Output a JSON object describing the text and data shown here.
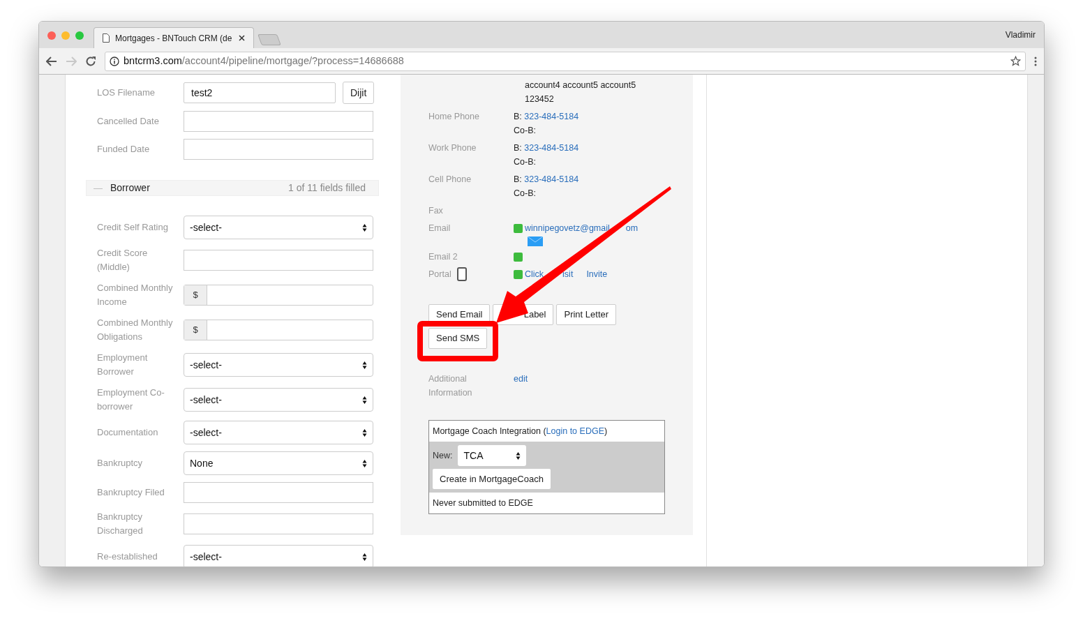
{
  "browser": {
    "tab_title": "Mortgages - BNTouch CRM (de",
    "user": "Vladimir",
    "url_host": "bntcrm3.com",
    "url_path": "/account4/pipeline/mortgage/?process=14686688"
  },
  "form": {
    "top_fields": [
      {
        "kind": "text_button",
        "label": "LOS Filename",
        "value": "test2",
        "button": "Dijit"
      },
      {
        "kind": "text",
        "label": "Cancelled Date"
      },
      {
        "kind": "text",
        "label": "Funded Date"
      }
    ],
    "section": {
      "title": "Borrower",
      "toggle": "—",
      "expanded": true,
      "summary": "1 of 11 fields filled"
    },
    "fields": [
      {
        "kind": "select",
        "label": "Credit Self Rating",
        "value": "-select-"
      },
      {
        "kind": "text",
        "label": "Credit Score (Middle)"
      },
      {
        "kind": "money",
        "label": "Combined Monthly Income",
        "prefix": "$"
      },
      {
        "kind": "money",
        "label": "Combined Monthly Obligations",
        "prefix": "$"
      },
      {
        "kind": "select",
        "label": "Employment Borrower",
        "value": "-select-"
      },
      {
        "kind": "select",
        "label": "Employment Co-borrower",
        "value": "-select-"
      },
      {
        "kind": "select",
        "label": "Documentation",
        "value": "-select-"
      },
      {
        "kind": "select",
        "label": "Bankruptcy",
        "value": "None"
      },
      {
        "kind": "text",
        "label": "Bankruptcy Filed"
      },
      {
        "kind": "text",
        "label": "Bankruptcy Discharged"
      },
      {
        "kind": "select",
        "label": "Re-established",
        "value": "-select-"
      }
    ]
  },
  "contact": {
    "address_lines": [
      "account4 account5 account5",
      "123452"
    ],
    "rows": [
      {
        "kind": "phone",
        "label": "Home Phone",
        "b": "B:",
        "phone": "323-484-5184",
        "cob": "Co-B:"
      },
      {
        "kind": "phone",
        "label": "Work Phone",
        "b": "B:",
        "phone": "323-484-5184",
        "cob": "Co-B:"
      },
      {
        "kind": "phone",
        "label": "Cell Phone",
        "b": "B:",
        "phone": "323-484-5184",
        "cob": "Co-B:"
      },
      {
        "kind": "plain",
        "label": "Fax"
      },
      {
        "kind": "email",
        "label": "Email",
        "color": "#3dbb3d",
        "link": "winnipegovetz@gmail",
        "link_tail": "om"
      },
      {
        "kind": "email",
        "label": "Email 2",
        "color": "#3dbb3d"
      },
      {
        "kind": "portal",
        "label": "Portal",
        "color": "#3dbb3d",
        "link": "Click",
        "link_tail": "isit",
        "link2": "Invite"
      }
    ],
    "buttons": [
      "Send Email",
      "Label",
      "Print Letter",
      "Send SMS"
    ],
    "additional": {
      "label": "Additional Information",
      "link": "edit"
    },
    "coach": {
      "title": "Mortgage Coach Integration (",
      "link": "Login to EDGE",
      "title_end": ")",
      "new_label": "New:",
      "new_value": "TCA",
      "create": "Create in MortgageCoach",
      "status": "Never submitted to EDGE"
    }
  }
}
